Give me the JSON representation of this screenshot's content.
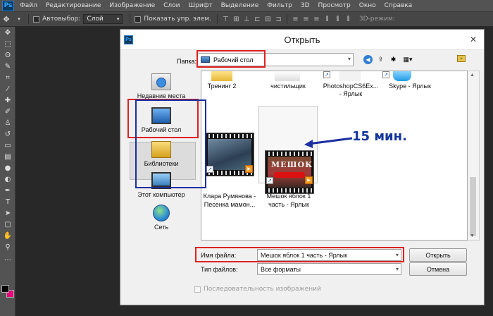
{
  "app": {
    "logo": "Ps",
    "menu": [
      "Файл",
      "Редактирование",
      "Изображение",
      "Слои",
      "Шрифт",
      "Выделение",
      "Фильтр",
      "3D",
      "Просмотр",
      "Окно",
      "Справка"
    ]
  },
  "options_bar": {
    "auto_select_label": "Автовыбор:",
    "auto_select_value": "Слой",
    "show_transform_label": "Показать упр. элем.",
    "mode_3d_label": "3D-режим:"
  },
  "dialog": {
    "title": "Открыть",
    "close_glyph": "✕",
    "look_in_label": "Папка:",
    "look_in_value": "Рабочий стол",
    "places": [
      {
        "label": "Недавние места",
        "icon": "recent-places-icon"
      },
      {
        "label": "Рабочий стол",
        "icon": "desktop-icon"
      },
      {
        "label": "Библиотеки",
        "icon": "libraries-icon"
      },
      {
        "label": "Этот компьютер",
        "icon": "computer-icon"
      },
      {
        "label": "Сеть",
        "icon": "network-icon"
      }
    ],
    "files_top": [
      {
        "label": "Тренинг 2"
      },
      {
        "label": "чистильщик"
      },
      {
        "label": "PhotoshopCS6Ex...",
        "label2": "- Ярлык"
      },
      {
        "label": "Skype - Ярлык"
      }
    ],
    "files_main": [
      {
        "label": "Клара Румянова -",
        "label2": "Песенка мамон..."
      },
      {
        "label": "Мешок яблок 1",
        "label2": "часть - Ярлык",
        "thumb_title": "МЕШОК",
        "thumb_sub": "ЯБЛОК"
      }
    ],
    "annotation": "15 мин.",
    "file_name_label": "Имя файла:",
    "file_name_value": "Мешок яблок 1 часть - Ярлык",
    "file_type_label": "Тип файлов:",
    "file_type_value": "Все форматы",
    "open_button": "Открыть",
    "cancel_button": "Отмена",
    "sequence_label": "Последовательность изображений"
  },
  "colors": {
    "annotation_red": "#e02020",
    "annotation_blue": "#1b2fa0",
    "foreground_swatch": "#000000",
    "background_swatch": "#e8007a"
  }
}
